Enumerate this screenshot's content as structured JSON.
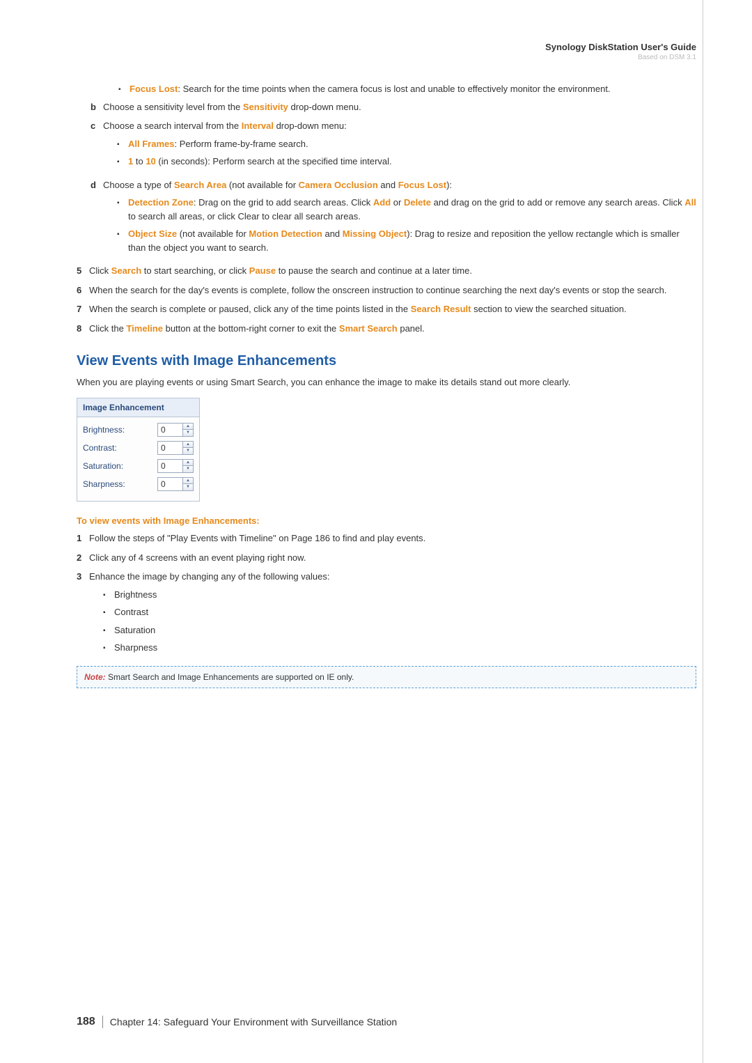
{
  "header": {
    "title": "Synology DiskStation User's Guide",
    "sub": "Based on DSM 3.1"
  },
  "focus_lost_label": "Focus Lost",
  "focus_lost_text": ": Search for the time points when the camera focus is lost and unable to effectively monitor the environment.",
  "step_b_pre": "Choose a sensitivity level from the ",
  "sensitivity": "Sensitivity",
  "step_b_post": " drop-down menu.",
  "step_c_pre": "Choose a search interval from the ",
  "interval": "Interval",
  "step_c_post": " drop-down menu:",
  "all_frames": "All Frames",
  "all_frames_text": ": Perform frame-by-frame search.",
  "one": "1",
  "to_word": " to ",
  "ten": "10",
  "interval_text": " (in seconds): Perform search at the specified time interval.",
  "step_d_pre": "Choose a type of ",
  "search_area": "Search Area",
  "step_d_mid": " (not available for ",
  "camera_occlusion": "Camera Occlusion",
  "and_word": " and ",
  "focus_lost2": "Focus Lost",
  "step_d_end": "):",
  "detection_zone": "Detection Zone",
  "dz_text1": ": Drag on the grid to add search areas. Click ",
  "add": "Add",
  "or_word": " or ",
  "delete": "Delete",
  "dz_text2": " and drag on the grid to add or remove any search areas. Click ",
  "all": "All",
  "dz_text3": " to search all areas, or click Clear to clear all search areas.",
  "object_size": "Object Size",
  "os_text1": " (not available for ",
  "motion_detection": "Motion Detection",
  "missing_object": "Missing Object",
  "os_text2": "): Drag to resize and reposition the yellow rectangle which is smaller than the object you want to search.",
  "step5_pre": "Click ",
  "search": "Search",
  "step5_mid": " to start searching, or click ",
  "pause": "Pause",
  "step5_post": " to pause the search and continue at a later time.",
  "step6": "When the search for the day's events is complete, follow the onscreen instruction to continue searching the next day's events or stop the search.",
  "step7_pre": "When the search is complete or paused, click any of the time points listed in the ",
  "search_result": "Search Result",
  "step7_post": " section to view the searched situation.",
  "step8_pre": "Click the ",
  "timeline": "Timeline",
  "step8_mid": " button at the bottom-right corner to exit the ",
  "smart_search": "Smart Search",
  "step8_post": " panel.",
  "heading": "View Events with Image Enhancements",
  "heading_para": "When you are playing events or using Smart Search, you can enhance the image to make its details stand out more clearly.",
  "panel": {
    "title": "Image Enhancement",
    "brightness": "Brightness:",
    "contrast": "Contrast:",
    "saturation": "Saturation:",
    "sharpness": "Sharpness:",
    "val": "0"
  },
  "subsection": "To view events with Image Enhancements:",
  "s1": "Follow the steps of \"Play Events with Timeline\" on Page 186 to find and play events.",
  "s2": "Click any of 4 screens with an event playing right now.",
  "s3": "Enhance the image by changing any of the following values:",
  "b_brightness": "Brightness",
  "b_contrast": "Contrast",
  "b_saturation": "Saturation",
  "b_sharpness": "Sharpness",
  "note_label": "Note:",
  "note_text": " Smart Search and Image Enhancements are supported on IE only.",
  "footer": {
    "page": "188",
    "chapter": "Chapter 14: Safeguard Your Environment with Surveillance Station"
  }
}
